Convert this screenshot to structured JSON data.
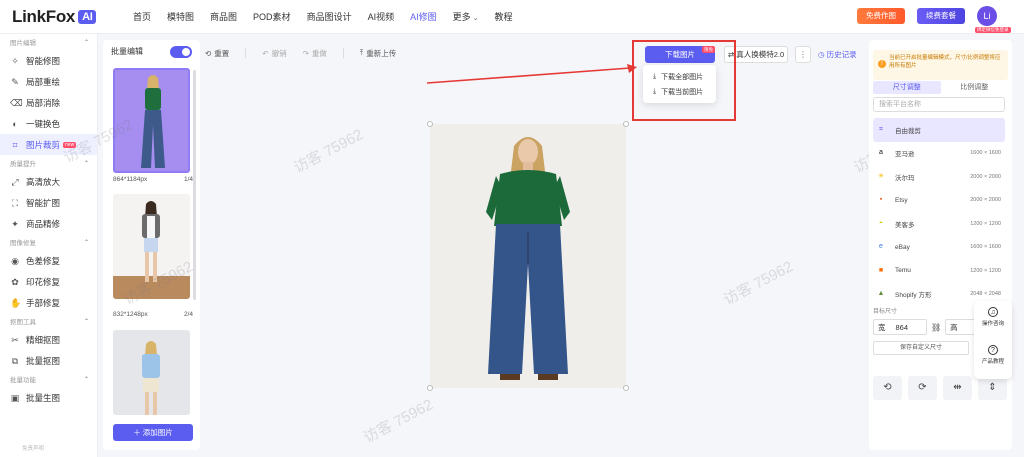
{
  "brand": {
    "name": "LinkFox",
    "badge": "AI"
  },
  "nav": {
    "items": [
      "首页",
      "模特图",
      "商品图",
      "POD素材",
      "商品图设计",
      "AI视频",
      "AI修图",
      "更多",
      "教程"
    ],
    "active": "AI修图"
  },
  "header_actions": {
    "free_label": "免费作图",
    "member_label": "续费套餐",
    "avatar_text": "Li",
    "avatar_tag": "绑定微信免登录"
  },
  "sidebar": {
    "sections": [
      {
        "title": "图片编辑",
        "items": [
          {
            "label": "智能修图",
            "icon": "magic-wand-icon"
          },
          {
            "label": "局部重绘",
            "icon": "brush-icon"
          },
          {
            "label": "局部消除",
            "icon": "eraser-icon"
          },
          {
            "label": "一键换色",
            "icon": "color-icon"
          },
          {
            "label": "图片裁剪",
            "icon": "crop-icon",
            "active": true,
            "tag": "new"
          }
        ]
      },
      {
        "title": "质量提升",
        "items": [
          {
            "label": "高清放大",
            "icon": "upscale-icon"
          },
          {
            "label": "智能扩图",
            "icon": "expand-icon"
          },
          {
            "label": "商品精修",
            "icon": "retouch-icon"
          }
        ]
      },
      {
        "title": "图像修复",
        "items": [
          {
            "label": "色差修复",
            "icon": "palette-icon"
          },
          {
            "label": "印花修复",
            "icon": "flower-icon"
          },
          {
            "label": "手部修复",
            "icon": "hand-icon"
          }
        ]
      },
      {
        "title": "抠图工具",
        "items": [
          {
            "label": "精细抠图",
            "icon": "cutout-icon"
          },
          {
            "label": "批量抠图",
            "icon": "batch-cutout-icon"
          }
        ]
      },
      {
        "title": "批量功能",
        "items": [
          {
            "label": "批量生图",
            "icon": "batch-gen-icon"
          }
        ]
      }
    ],
    "footer": "免责声明"
  },
  "batch": {
    "title": "批量编辑",
    "thumbs": [
      {
        "size": "864*1184px",
        "index": "1/4"
      },
      {
        "size": "832*1248px",
        "index": "2/4"
      },
      {
        "size": "",
        "index": ""
      }
    ],
    "add_label": "添加图片"
  },
  "toolbar": {
    "reset": "重置",
    "undo": "撤销",
    "redo": "重做",
    "reupload": "重新上传"
  },
  "download": {
    "button": "下载图片",
    "tag": "限免",
    "menu": [
      "下载全部图片",
      "下载当前图片"
    ],
    "swap": "真人换模特2.0",
    "history": "历史记录"
  },
  "watermark": "访客 75962",
  "right_panel": {
    "notice": "当前已开启批量编辑模式，尺寸/比例调整将应用所有图片",
    "tabs": [
      "尺寸调整",
      "比例调整"
    ],
    "search_placeholder": "搜索平台名称",
    "platforms": [
      {
        "name": "自由裁剪",
        "size": "",
        "icon": "crop-icon",
        "color": "#5b5cf0",
        "selected": true
      },
      {
        "name": "亚马逊",
        "size": "1600 × 1600",
        "icon": "amazon-icon",
        "color": "#111111"
      },
      {
        "name": "沃尔玛",
        "size": "2000 × 2000",
        "icon": "walmart-icon",
        "color": "#f5b800"
      },
      {
        "name": "Etsy",
        "size": "2000 × 2000",
        "icon": "etsy-icon",
        "color": "#e8601c"
      },
      {
        "name": "美客多",
        "size": "1200 × 1200",
        "icon": "mercadolibre-icon",
        "color": "#d9c400"
      },
      {
        "name": "eBay",
        "size": "1600 × 1600",
        "icon": "ebay-icon",
        "color": "#3a7bd5"
      },
      {
        "name": "Temu",
        "size": "1200 × 1200",
        "icon": "temu-icon",
        "color": "#ff6a00"
      },
      {
        "name": "Shopify 方形",
        "size": "2048 × 2048",
        "icon": "shopify-icon",
        "color": "#5e8e3e"
      }
    ],
    "custom_label": "目标尺寸",
    "width_label": "宽",
    "width_value": "864",
    "height_label": "高",
    "save_label": "保存自定义尺寸"
  },
  "float": {
    "consult": "操作咨询",
    "tutorial": "产品教程"
  }
}
